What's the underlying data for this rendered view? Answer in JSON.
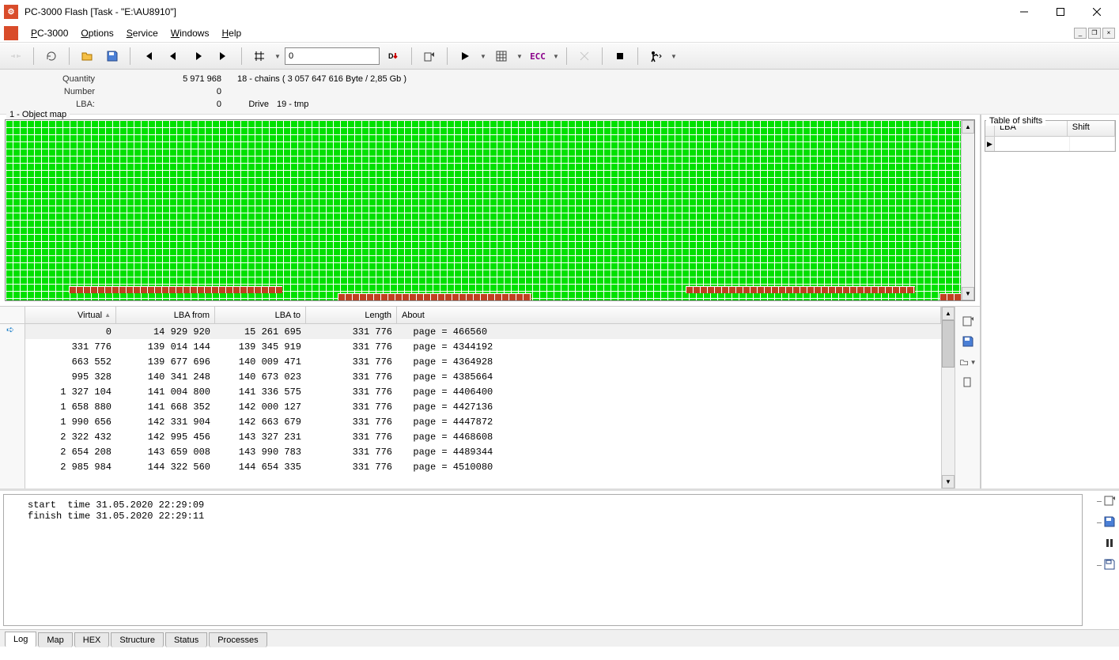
{
  "window": {
    "title": "PC-3000 Flash [Task - \"E:\\AU8910\"]"
  },
  "menu": {
    "items": [
      "PC-3000",
      "Options",
      "Service",
      "Windows",
      "Help"
    ]
  },
  "toolbar": {
    "numInput": "0",
    "ecc": "ECC"
  },
  "info": {
    "quantity_label": "Quantity",
    "quantity_value": "5 971 968",
    "chains": "18 - chains  ( 3 057 647 616 Byte /  2,85 Gb )",
    "number_label": "Number",
    "number_value": "0",
    "lba_label": "LBA:",
    "lba_value": "0",
    "drive_label": "Drive",
    "drive_value": "19 - tmp"
  },
  "objmap": {
    "title": "1 - Object map"
  },
  "table": {
    "headers": {
      "virtual": "Virtual",
      "lba_from": "LBA from",
      "lba_to": "LBA to",
      "length": "Length",
      "about": "About"
    },
    "rows": [
      {
        "virtual": "0",
        "lba_from": "14 929 920",
        "lba_to": "15 261 695",
        "length": "331 776",
        "about": "page = 466560"
      },
      {
        "virtual": "331 776",
        "lba_from": "139 014 144",
        "lba_to": "139 345 919",
        "length": "331 776",
        "about": "page = 4344192"
      },
      {
        "virtual": "663 552",
        "lba_from": "139 677 696",
        "lba_to": "140 009 471",
        "length": "331 776",
        "about": "page = 4364928"
      },
      {
        "virtual": "995 328",
        "lba_from": "140 341 248",
        "lba_to": "140 673 023",
        "length": "331 776",
        "about": "page = 4385664"
      },
      {
        "virtual": "1 327 104",
        "lba_from": "141 004 800",
        "lba_to": "141 336 575",
        "length": "331 776",
        "about": "page = 4406400"
      },
      {
        "virtual": "1 658 880",
        "lba_from": "141 668 352",
        "lba_to": "142 000 127",
        "length": "331 776",
        "about": "page = 4427136"
      },
      {
        "virtual": "1 990 656",
        "lba_from": "142 331 904",
        "lba_to": "142 663 679",
        "length": "331 776",
        "about": "page = 4447872"
      },
      {
        "virtual": "2 322 432",
        "lba_from": "142 995 456",
        "lba_to": "143 327 231",
        "length": "331 776",
        "about": "page = 4468608"
      },
      {
        "virtual": "2 654 208",
        "lba_from": "143 659 008",
        "lba_to": "143 990 783",
        "length": "331 776",
        "about": "page = 4489344"
      },
      {
        "virtual": "2 985 984",
        "lba_from": "144 322 560",
        "lba_to": "144 654 335",
        "length": "331 776",
        "about": "page = 4510080"
      }
    ]
  },
  "shifts": {
    "title": "Table of shifts",
    "col1": "LBA",
    "col2": "Shift"
  },
  "log": {
    "lines": [
      "start  time 31.05.2020 22:29:09",
      "finish time 31.05.2020 22:29:11"
    ]
  },
  "tabs": {
    "items": [
      "Log",
      "Map",
      "HEX",
      "Structure",
      "Status",
      "Processes"
    ],
    "active": 0
  }
}
